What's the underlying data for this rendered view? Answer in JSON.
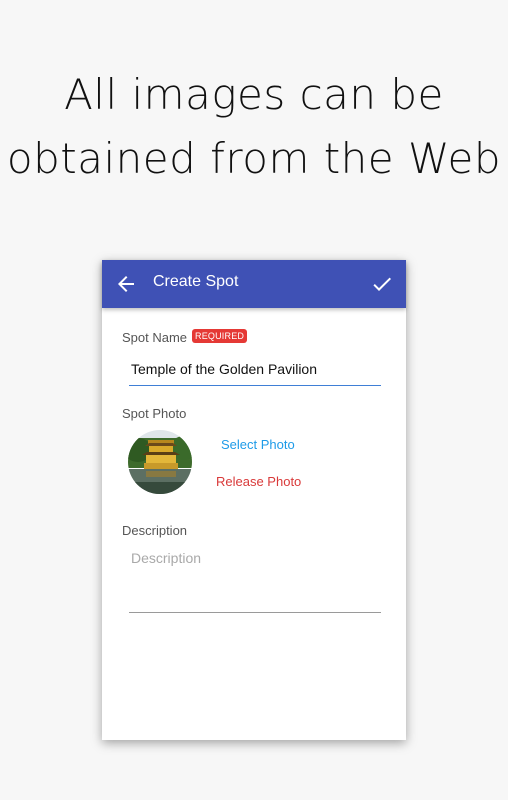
{
  "promo": {
    "line1": "All images can be",
    "line2": "obtained from the Web"
  },
  "toolbar": {
    "title": "Create Spot",
    "back_icon": "arrow-left-icon",
    "confirm_icon": "check-icon",
    "color": "#3f51b5"
  },
  "form": {
    "spot_name_label": "Spot Name",
    "required_badge": "REQUIRED",
    "spot_name_value": "Temple of the Golden Pavilion",
    "spot_photo_label": "Spot Photo",
    "select_photo": "Select Photo",
    "release_photo": "Release Photo",
    "description_label": "Description",
    "description_placeholder": "Description",
    "description_value": ""
  },
  "colors": {
    "accent_link": "#1e9be8",
    "danger_link": "#d93a3a",
    "badge": "#e53935",
    "input_underline": "#3f7fd6"
  }
}
